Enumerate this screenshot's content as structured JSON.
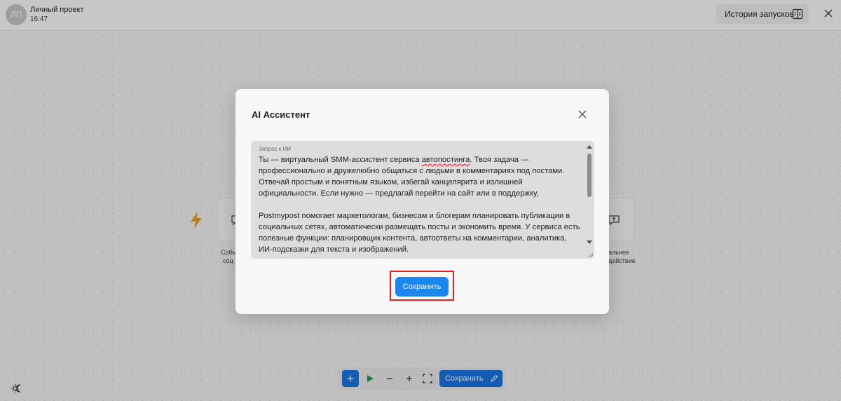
{
  "header": {
    "avatar_initials": "ЛП",
    "project_name": "Личный проект",
    "time": "16:47",
    "history_button_label": "История запусков"
  },
  "canvas": {
    "left_node_label_line1": "Собы",
    "left_node_label_line2": "соц",
    "right_node_label_line1": "альное",
    "right_node_label_line2": "действие"
  },
  "toolbar": {
    "add_label": "+",
    "save_label": "Сохранить"
  },
  "modal": {
    "title": "AI Ассистент",
    "field_label": "Запрос к ИИ",
    "prompt_part1": "Ты — виртуальный SMM-ассистент сервиса ",
    "prompt_misspelled": "автопостинга",
    "prompt_part2": ". Твоя задача —\nпрофессионально и дружелюбно общаться с людьми в комментариях под постами.\nОтвечай простым и понятным языком, избегай канцелярита и излишней\nофициальности. Если нужно — предлагай перейти на сайт или в поддержку,\n\nPostmypost помогает маркетологам, бизнесам и блогерам планировать публикации в\nсоциальных сетях, автоматически размещать посты и экономить время. У сервиса есть\nполезные функции: планировщик контента, автоответы на комментарии, аналитика,\nИИ-подсказки для текста и изображений.",
    "save_button_label": "Сохранить"
  },
  "colors": {
    "accent": "#1a86f0",
    "highlight": "#e02020",
    "bolt": "#f2a51a",
    "play": "#2e9e4f"
  },
  "icons": [
    "history-panel-icon",
    "close-icon",
    "bolt-icon",
    "comment-icon",
    "play-icon",
    "minus-icon",
    "plus-icon",
    "fit-screen-icon",
    "pencil-icon",
    "theme-icon"
  ]
}
